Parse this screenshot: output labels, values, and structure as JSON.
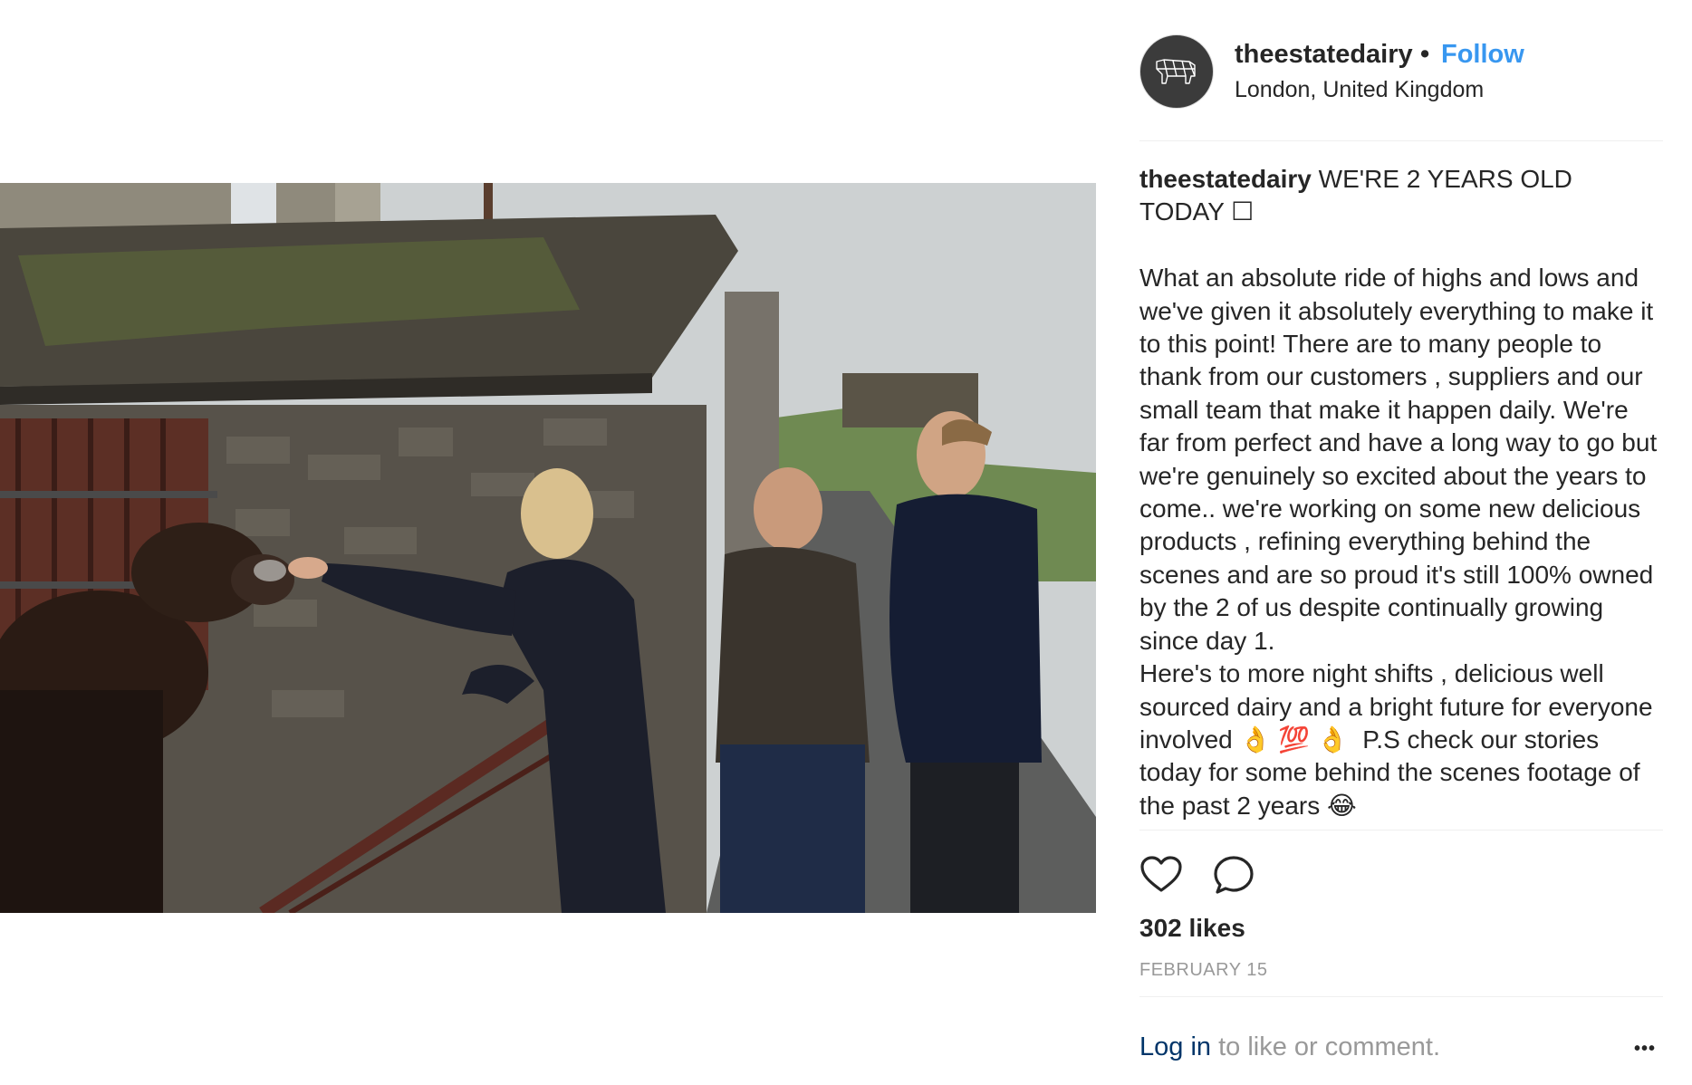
{
  "post": {
    "username": "theestatedairy",
    "separator": "•",
    "follow_label": "Follow",
    "location": "London, United Kingdom",
    "avatar_icon": "cow-logo-icon",
    "photo_alt": "photo-post-image"
  },
  "caption": {
    "username": "theestatedairy",
    "text": " WE'RE 2 YEARS OLD\nTODAY ☐\n\nWhat an absolute ride of highs and lows and we've given it absolutely everything to make it to this point! There are to many people to thank from our customers , suppliers and our small team that make it happen daily. We're far from perfect and have a long way to go but we're genuinely so excited about the years to come.. we're working on some new delicious products , refining everything behind the scenes and are so proud it's still 100% owned by the 2 of us despite continually growing since day 1.\nHere's to more night shifts , delicious well sourced dairy and a bright future for everyone involved 👌 💯 👌  P.S check our stories today for some behind the scenes footage of the past 2 years 😂"
  },
  "actions": {
    "like_icon": "heart-icon",
    "comment_icon": "comment-icon",
    "likes": "302 likes",
    "date": "FEBRUARY 15"
  },
  "footer": {
    "login_link": "Log in",
    "login_rest": " to like or comment.",
    "more_label": "•••"
  },
  "colors": {
    "link_blue": "#3897f0",
    "login_blue": "#003569",
    "text": "#262626",
    "muted": "#999999",
    "divider": "#efefef"
  }
}
